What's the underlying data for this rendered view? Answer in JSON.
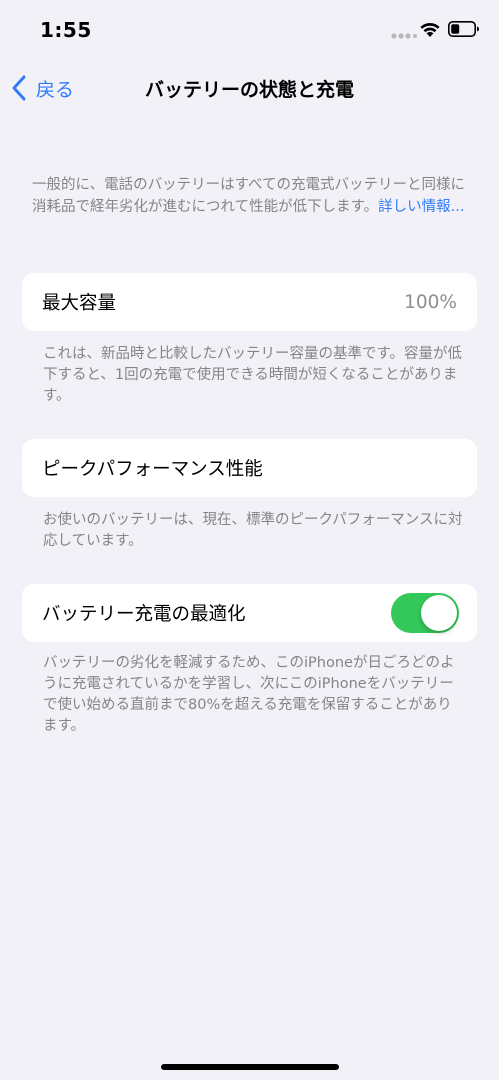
{
  "status_bar": {
    "time": "1:55"
  },
  "nav": {
    "back_label": "戻る",
    "title": "バッテリーの状態と充電"
  },
  "intro": {
    "text": "一般的に、電話のバッテリーはすべての充電式バッテリーと同様に消耗品で経年劣化が進むにつれて性能が低下します。",
    "link": "詳しい情報..."
  },
  "max_capacity": {
    "label": "最大容量",
    "value": "100%",
    "footnote": "これは、新品時と比較したバッテリー容量の基準です。容量が低下すると、1回の充電で使用できる時間が短くなることがあります。"
  },
  "peak_performance": {
    "label": "ピークパフォーマンス性能",
    "footnote": "お使いのバッテリーは、現在、標準のピークパフォーマンスに対応しています。"
  },
  "optimized_charging": {
    "label": "バッテリー充電の最適化",
    "enabled": true,
    "footnote": "バッテリーの劣化を軽減するため、このiPhoneが日ごろどのように充電されているかを学習し、次にこのiPhoneをバッテリーで使い始める直前まで80%を超える充電を保留することがあります。"
  },
  "colors": {
    "background": "#f2f1f7",
    "accent": "#2f7cf6",
    "toggle_on": "#34c759",
    "secondary_text": "#848489"
  },
  "icons": [
    "chevron-left-icon",
    "signal-dots-icon",
    "wifi-icon",
    "battery-icon"
  ]
}
